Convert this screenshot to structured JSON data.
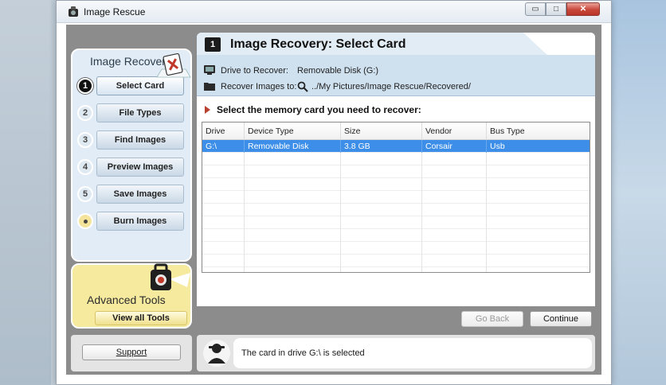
{
  "window": {
    "title": "Image Rescue",
    "controls": {
      "minimize": "▭",
      "maximize": "□",
      "close": "✕"
    }
  },
  "sidebar": {
    "header": "Image Recovery",
    "steps": [
      {
        "num": "1",
        "label": "Select Card",
        "active": true
      },
      {
        "num": "2",
        "label": "File Types"
      },
      {
        "num": "3",
        "label": "Find Images"
      },
      {
        "num": "4",
        "label": "Preview Images"
      },
      {
        "num": "5",
        "label": "Save Images"
      },
      {
        "num": "",
        "label": "Burn Images"
      }
    ]
  },
  "advanced": {
    "title": "Advanced Tools",
    "button": "View all Tools"
  },
  "main": {
    "step_num": "1",
    "title": "Image Recovery: Select Card",
    "drive_label": "Drive to Recover:",
    "drive_value": "Removable Disk (G:)",
    "recover_label": "Recover Images to:",
    "recover_value": "../My Pictures/Image Rescue/Recovered/",
    "prompt": "Select the memory card you need to recover:"
  },
  "table": {
    "headers": [
      "Drive",
      "Device Type",
      "Size",
      "Vendor",
      "Bus Type"
    ],
    "rows": [
      {
        "drive": "G:\\",
        "device_type": "Removable Disk",
        "size": "3.8 GB",
        "vendor": "Corsair",
        "bus_type": "Usb"
      }
    ]
  },
  "nav": {
    "back": "Go Back",
    "continue": "Continue"
  },
  "footer": {
    "support": "Support",
    "status": "The card in drive G:\\ is selected"
  },
  "colors": {
    "selected_row": "#3d8ee8",
    "info_band": "#cfe0ef",
    "sidebar_bg": "#e1ecf6",
    "advanced_bg": "#f6ea9f",
    "client_bg": "#8c8c8c"
  }
}
